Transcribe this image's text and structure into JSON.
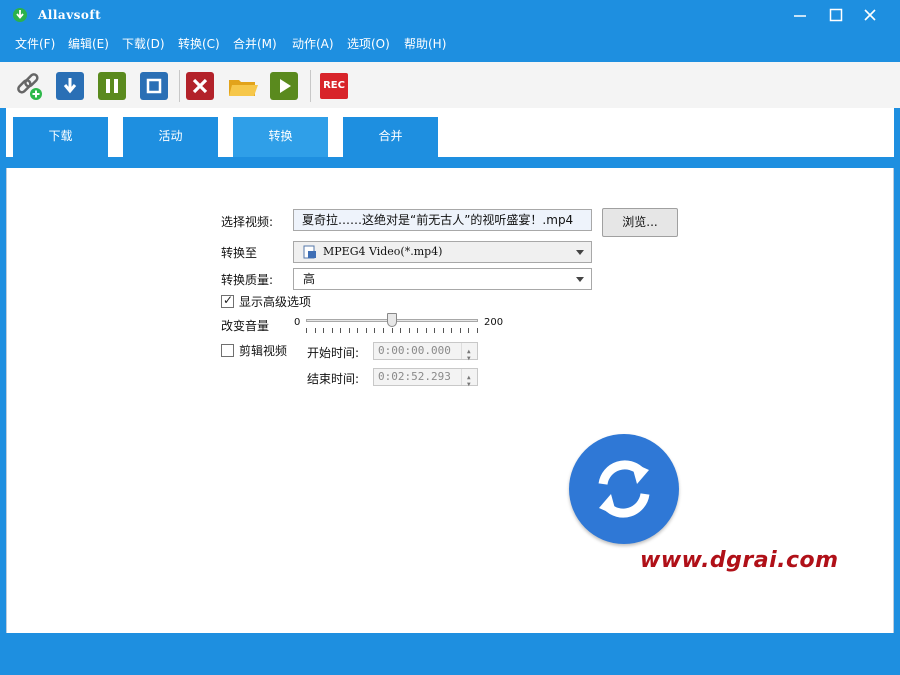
{
  "window": {
    "title": "Allavsoft"
  },
  "menu": [
    "文件(F)",
    "编辑(E)",
    "下载(D)",
    "转换(C)",
    "合并(M)",
    "动作(A)",
    "选项(O)",
    "帮助(H)"
  ],
  "toolbar": {
    "add_link_icon": "link-add-icon",
    "download_icon": "download-icon",
    "pause_icon": "pause-icon",
    "stop_icon": "stop-icon",
    "delete_icon": "delete-icon",
    "folder_icon": "folder-icon",
    "play_icon": "play-icon",
    "rec_label": "REC"
  },
  "tabs": [
    {
      "label": "下载",
      "active": false
    },
    {
      "label": "活动",
      "active": false
    },
    {
      "label": "转换",
      "active": true
    },
    {
      "label": "合并",
      "active": false
    }
  ],
  "convert": {
    "select_video_label": "选择视频:",
    "select_video_value": "夏奇拉……这绝对是“前无古人”的视听盛宴！.mp4",
    "browse_label": "浏览...",
    "convert_to_label": "转换至",
    "convert_to_value": "MPEG4 Video(*.mp4)",
    "quality_label": "转换质量:",
    "quality_value": "高",
    "advanced_label": "显示高级选项",
    "advanced_checked": true,
    "volume_label": "改变音量",
    "volume_min": "0",
    "volume_max": "200",
    "volume_value": 100,
    "trim_label": "剪辑视频",
    "trim_checked": false,
    "start_label": "开始时间:",
    "start_value": "0:00:00.000",
    "end_label": "结束时间:",
    "end_value": "0:02:52.293"
  },
  "watermark": "www.dgrai.com",
  "colors": {
    "accent": "#1e8fe0",
    "convert_circle": "#2f78d6",
    "watermark": "#b01018"
  }
}
